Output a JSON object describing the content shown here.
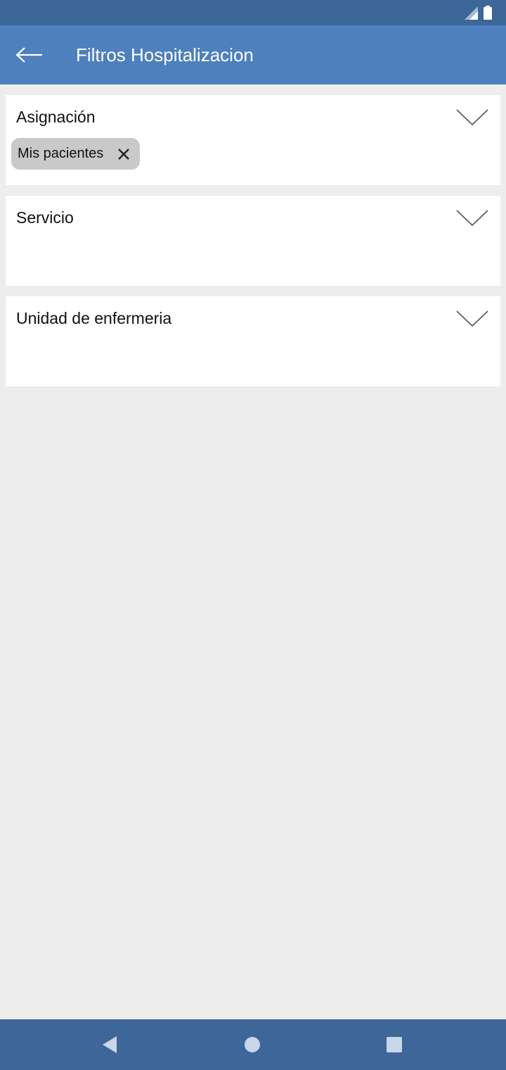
{
  "header": {
    "title": "Filtros Hospitalizacion",
    "back_icon": "back-arrow-icon",
    "color": "#4d80bd"
  },
  "status_bar": {
    "icons": [
      "signal-icon",
      "battery-icon"
    ],
    "color": "#3d6699"
  },
  "filters": [
    {
      "label": "Asignación",
      "chips": [
        {
          "label": "Mis pacientes"
        }
      ]
    },
    {
      "label": "Servicio",
      "chips": []
    },
    {
      "label": "Unidad de enfermeria",
      "chips": []
    }
  ],
  "nav_bar": {
    "buttons": [
      "nav-back-icon",
      "nav-home-icon",
      "nav-recents-icon"
    ]
  }
}
